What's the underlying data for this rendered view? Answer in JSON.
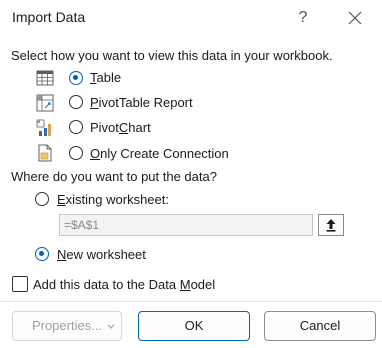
{
  "dialog": {
    "title": "Import Data",
    "help_glyph": "?",
    "close_icon": "close-icon"
  },
  "view_section": {
    "prompt": "Select how you want to view this data in your workbook.",
    "options": [
      {
        "pre": "",
        "accel": "T",
        "post": "able",
        "checked": true,
        "icon": "table-icon"
      },
      {
        "pre": "",
        "accel": "P",
        "post": "ivotTable Report",
        "checked": false,
        "icon": "pivottable-icon"
      },
      {
        "pre": "Pivot",
        "accel": "C",
        "post": "hart",
        "checked": false,
        "icon": "pivotchart-icon"
      },
      {
        "pre": "",
        "accel": "O",
        "post": "nly Create Connection",
        "checked": false,
        "icon": "connection-only-icon"
      }
    ]
  },
  "destination_section": {
    "prompt": "Where do you want to put the data?",
    "existing": {
      "pre": "",
      "accel": "E",
      "post": "xisting worksheet:",
      "checked": false
    },
    "range_value": "=$A$1",
    "new": {
      "pre": "",
      "accel": "N",
      "post": "ew worksheet",
      "checked": true
    }
  },
  "data_model": {
    "pre": "Add this data to the Data ",
    "accel": "M",
    "post": "odel",
    "checked": false
  },
  "buttons": {
    "properties": "Properties...",
    "ok": "OK",
    "cancel": "Cancel"
  },
  "colors": {
    "accent": "#0060c0"
  }
}
